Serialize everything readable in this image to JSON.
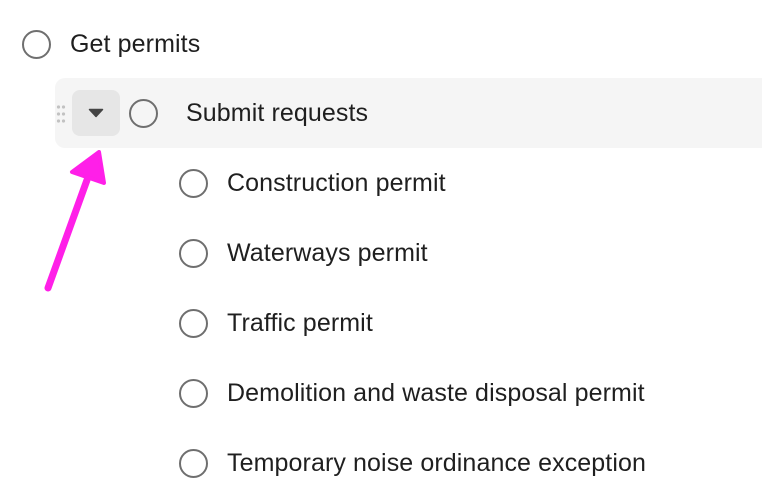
{
  "tasks": [
    {
      "label": "Get permits"
    },
    {
      "label": "Submit requests"
    },
    {
      "label": "Construction permit"
    },
    {
      "label": "Waterways permit"
    },
    {
      "label": "Traffic permit"
    },
    {
      "label": "Demolition and waste disposal permit"
    },
    {
      "label": "Temporary noise ordinance exception"
    }
  ],
  "icons": {
    "toggle": "caret-down-icon",
    "drag": "drag-handle-icon",
    "annotation": "arrow-icon"
  },
  "colors": {
    "annotation_arrow": "#ff1fe8",
    "row_highlight": "#f5f5f5",
    "toggle_bg": "#e6e6e6",
    "checkbox_border": "#6f6f6f",
    "text": "#1f1f1f"
  }
}
